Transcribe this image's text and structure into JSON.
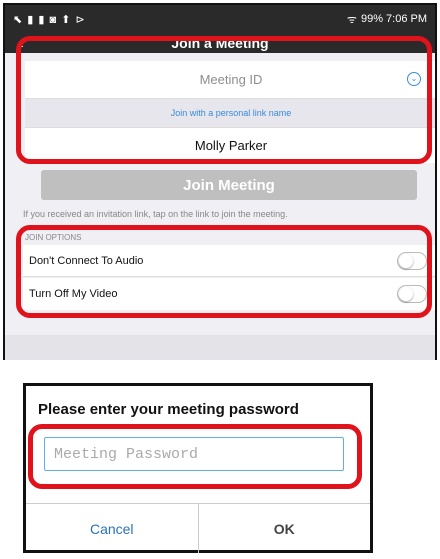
{
  "status_bar": {
    "icons": "⬉ ▮ ▮ ◙ ⬆ ⊳",
    "signal": "ᯤ",
    "time": "99% 7:06 PM"
  },
  "header": {
    "title": "Join a Meeting",
    "back": "‹"
  },
  "form": {
    "meeting_id_placeholder": "Meeting ID",
    "dropdown_glyph": "⌄",
    "personal_link_label": "Join with a personal link name",
    "name_value": "Molly Parker",
    "join_button": "Join Meeting",
    "hint": "If you received an invitation link, tap on the link to join the meeting."
  },
  "join_options": {
    "header": "JOIN OPTIONS",
    "items": [
      {
        "label": "Don't Connect To Audio",
        "on": false
      },
      {
        "label": "Turn Off My Video",
        "on": false
      }
    ]
  },
  "password_dialog": {
    "title": "Please enter your meeting password",
    "placeholder": "Meeting Password",
    "cancel": "Cancel",
    "ok": "OK"
  },
  "colors": {
    "highlight": "#e0121c",
    "accent": "#3a8cdb",
    "status_bar": "#2a2a2a"
  }
}
